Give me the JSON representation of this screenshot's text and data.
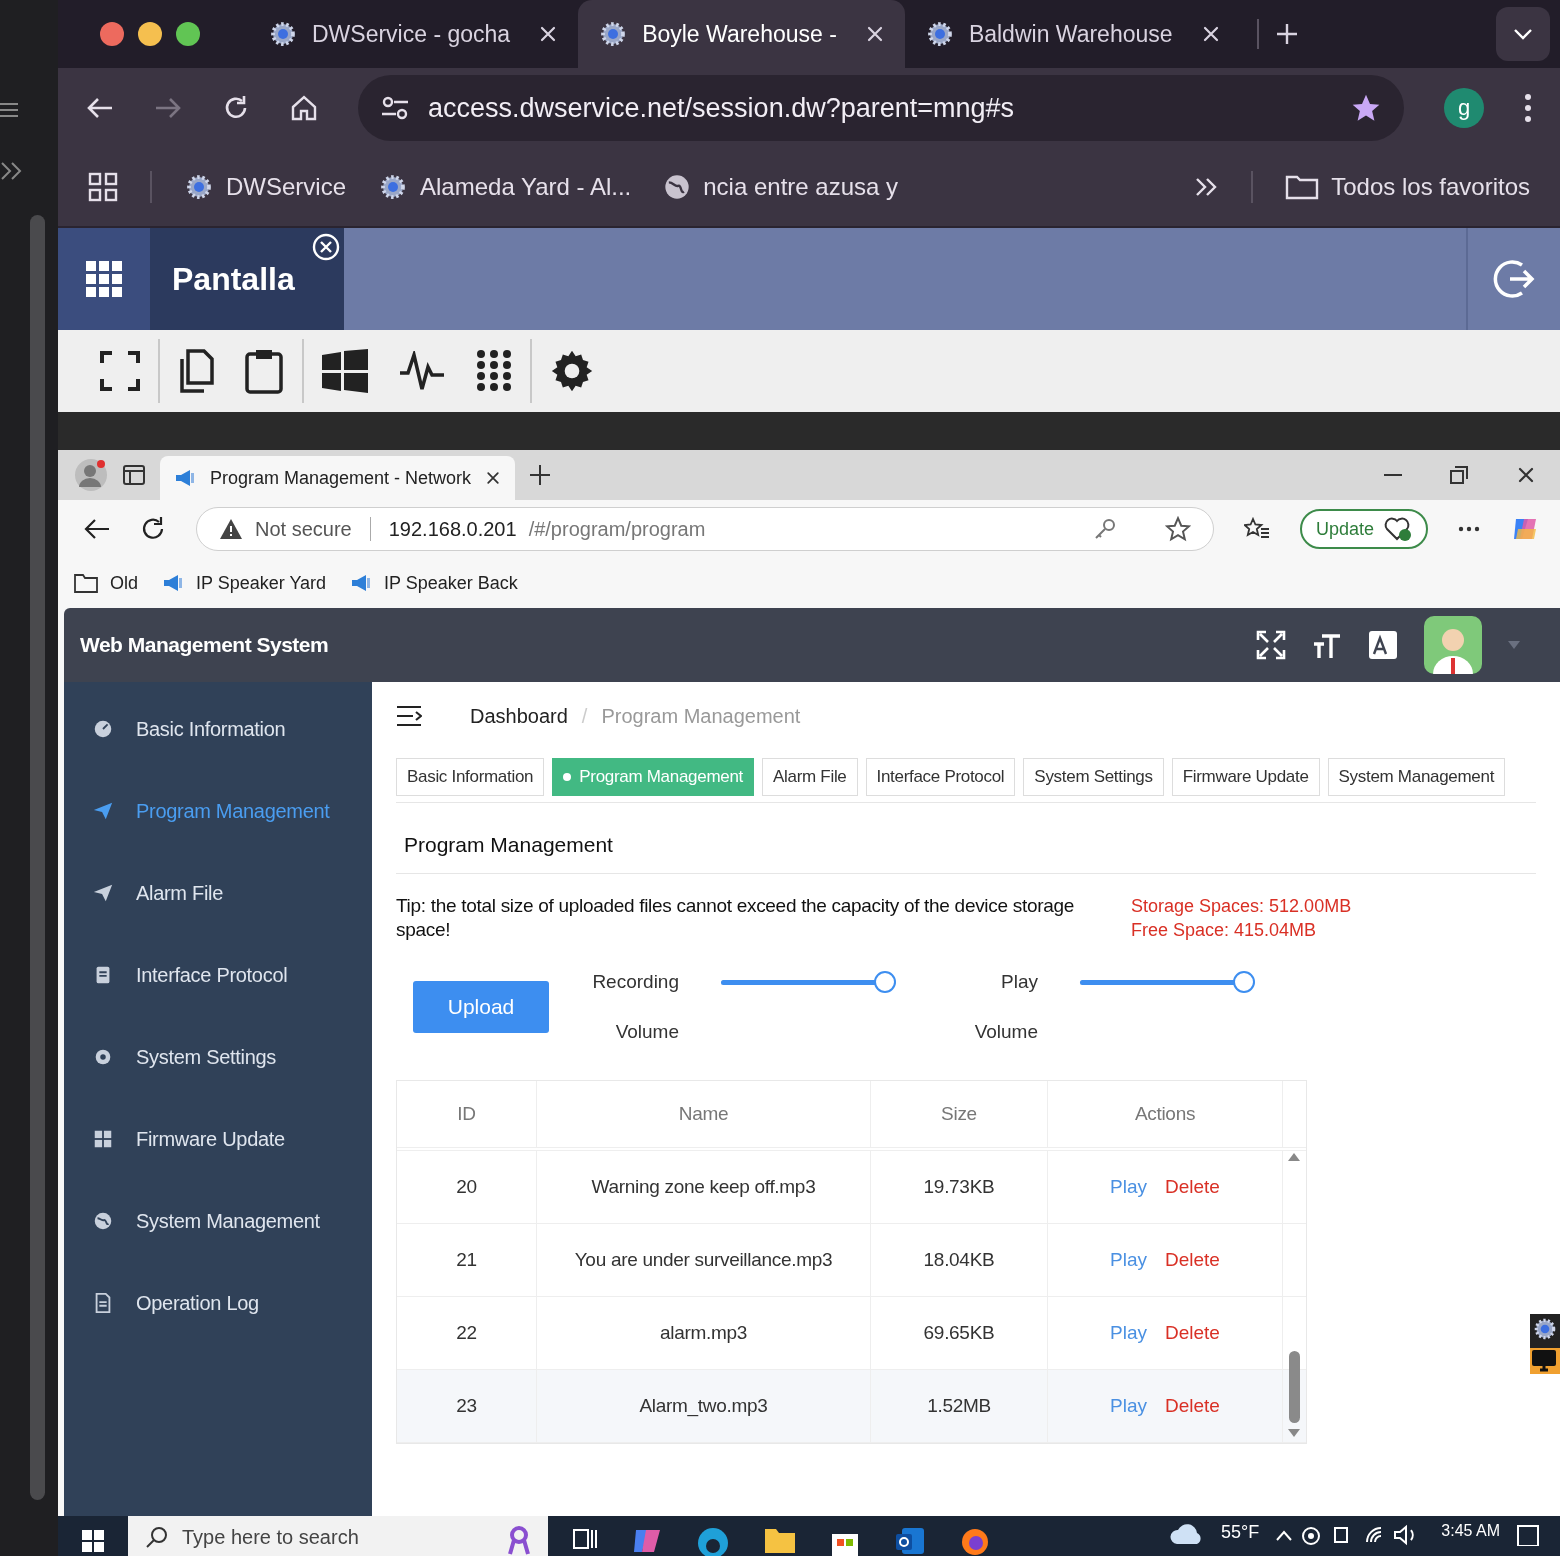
{
  "chrome_tabs": [
    {
      "title": "DWService - gocha",
      "selected": false
    },
    {
      "title": "Boyle Warehouse -",
      "selected": true
    },
    {
      "title": "Baldwin Warehouse",
      "selected": false
    }
  ],
  "address_bar": {
    "url": "access.dwservice.net/session.dw?parent=mng#s"
  },
  "profile_initial": "g",
  "bookmarks": [
    {
      "label": "DWService",
      "kind": "site"
    },
    {
      "label": "Alameda Yard - Al...",
      "kind": "site"
    },
    {
      "label": "ncia entre azusa y",
      "kind": "globe"
    }
  ],
  "all_bookmarks": "Todos los favoritos",
  "session_tab": {
    "label": "Pantalla"
  },
  "remote_browser": {
    "tab_title": "Program Management - Network",
    "security": "Not secure",
    "url_host": "192.168.0.201",
    "url_path": "/#/program/program",
    "update_button": "Update",
    "bookmarks": [
      {
        "label": "Old",
        "kind": "folder"
      },
      {
        "label": "IP Speaker Yard",
        "kind": "speaker"
      },
      {
        "label": "IP Speaker Back",
        "kind": "speaker"
      }
    ]
  },
  "app": {
    "title": "Web Management System",
    "sidebar": [
      {
        "label": "Basic Information",
        "selected": false
      },
      {
        "label": "Program Management",
        "selected": true
      },
      {
        "label": "Alarm File",
        "selected": false
      },
      {
        "label": "Interface Protocol",
        "selected": false
      },
      {
        "label": "System Settings",
        "selected": false
      },
      {
        "label": "Firmware Update",
        "selected": false
      },
      {
        "label": "System Management",
        "selected": false
      },
      {
        "label": "Operation Log",
        "selected": false
      }
    ],
    "breadcrumb": [
      "Dashboard",
      "Program Management"
    ],
    "breadcrumb_separator": "/",
    "tabs": [
      {
        "label": "Basic Information",
        "selected": false
      },
      {
        "label": "Program Management",
        "selected": true
      },
      {
        "label": "Alarm File",
        "selected": false
      },
      {
        "label": "Interface Protocol",
        "selected": false
      },
      {
        "label": "System Settings",
        "selected": false
      },
      {
        "label": "Firmware Update",
        "selected": false
      },
      {
        "label": "System Management",
        "selected": false
      }
    ],
    "section_title": "Program Management",
    "tip": "Tip: the total size of uploaded files cannot exceed the capacity of the device storage space!",
    "storage": "Storage Spaces: 512.00MB",
    "free_space": "Free Space: 415.04MB",
    "upload_button": "Upload",
    "sliders": [
      {
        "label_top": "Recording",
        "label_bottom": "Volume",
        "level": 0.94
      },
      {
        "label_top": "Play",
        "label_bottom": "Volume",
        "level": 0.94
      }
    ],
    "table": {
      "columns": [
        "ID",
        "Name",
        "Size",
        "Actions"
      ],
      "rows": [
        {
          "id": "20",
          "name": "Warning zone keep off.mp3",
          "size": "19.73KB",
          "actions": [
            "Play",
            "Delete"
          ],
          "hovered": false
        },
        {
          "id": "21",
          "name": "You are under surveillance.mp3",
          "size": "18.04KB",
          "actions": [
            "Play",
            "Delete"
          ],
          "hovered": false
        },
        {
          "id": "22",
          "name": "alarm.mp3",
          "size": "69.65KB",
          "actions": [
            "Play",
            "Delete"
          ],
          "hovered": false
        },
        {
          "id": "23",
          "name": "Alarm_two.mp3",
          "size": "1.52MB",
          "actions": [
            "Play",
            "Delete"
          ],
          "hovered": true
        }
      ]
    }
  },
  "taskbar": {
    "search_placeholder": "Type here to search",
    "weather": "55°F",
    "time": "3:45 AM"
  }
}
